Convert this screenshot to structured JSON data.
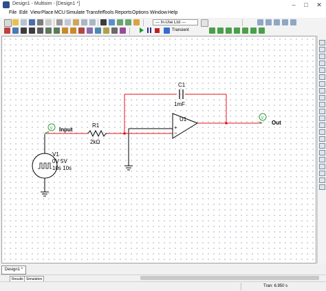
{
  "window": {
    "title": "Design1 - Multisim - [Design1 *]"
  },
  "menu": [
    "File",
    "Edit",
    "View",
    "Place",
    "MCU",
    "Simulate",
    "Transfer",
    "Tools",
    "Reports",
    "Options",
    "Window",
    "Help"
  ],
  "toolbar": {
    "in_use_list": "--- In-Use List ---",
    "analysis": "Transient"
  },
  "schematic": {
    "source": {
      "ref": "V1",
      "value": "0V 5V",
      "timing": "10s 10s"
    },
    "resistor": {
      "ref": "R1",
      "value": "2kΩ"
    },
    "capacitor": {
      "ref": "C1",
      "value": "1mF"
    },
    "opamp": {
      "ref": "U1",
      "minus": "−",
      "plus": "+"
    },
    "input_label": "Input",
    "output_label": "Out",
    "probe_letter": "V",
    "colors": {
      "wire_red": "#e8101a",
      "wire_black": "#000000",
      "probe_green": "#2e9b3a"
    }
  },
  "tabs": {
    "design": "Design1 *"
  },
  "sheet_tabs": [
    "Results",
    "Simulation"
  ],
  "status": {
    "tran": "Tran: 6.950 s"
  }
}
